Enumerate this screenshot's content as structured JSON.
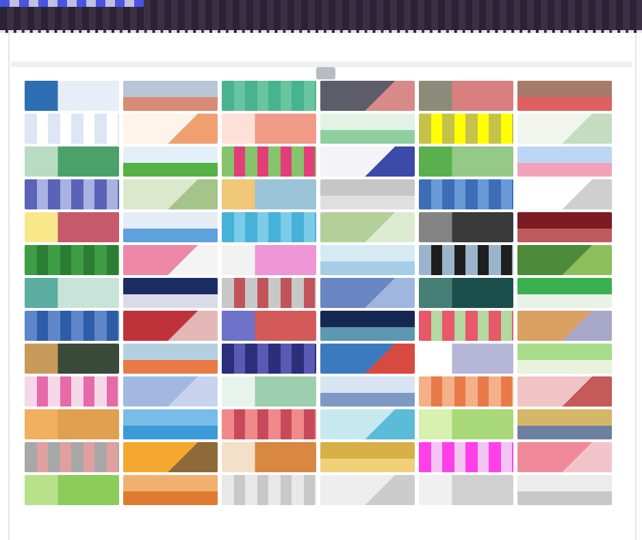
{
  "topbar": {
    "bg": "#2b2236"
  },
  "header": {
    "subtitle": ""
  },
  "thumbnails": [
    {
      "c": [
        "#2e6fb3",
        "#e8eef7"
      ]
    },
    {
      "c": [
        "#b9c6d8",
        "#d88c75"
      ]
    },
    {
      "c": [
        "#47b38f",
        "#69c4a0"
      ]
    },
    {
      "c": [
        "#5d5d6a",
        "#d88a88"
      ]
    },
    {
      "c": [
        "#8b8b7a",
        "#d87f7f"
      ]
    },
    {
      "c": [
        "#a87a6a",
        "#e06060"
      ]
    },
    {
      "c": [
        "#dde6f5",
        "#ffffff"
      ]
    },
    {
      "c": [
        "#fff4ea",
        "#f0a070"
      ]
    },
    {
      "c": [
        "#fde0d8",
        "#f29a88"
      ]
    },
    {
      "c": [
        "#e2f2e6",
        "#8fcf9f"
      ]
    },
    {
      "c": [
        "#c5c24a",
        "#ffff00"
      ]
    },
    {
      "c": [
        "#f0f5ee",
        "#c4dcc0"
      ]
    },
    {
      "c": [
        "#b8dcc2",
        "#4aa26a"
      ]
    },
    {
      "c": [
        "#e5effa",
        "#53b241"
      ]
    },
    {
      "c": [
        "#85c46a",
        "#e23e78"
      ]
    },
    {
      "c": [
        "#f4f4f8",
        "#3c4aa8"
      ]
    },
    {
      "c": [
        "#5ab04c",
        "#96c887"
      ]
    },
    {
      "c": [
        "#bcd7f4",
        "#f0a3b8"
      ]
    },
    {
      "c": [
        "#5a63b8",
        "#a9b2e0"
      ]
    },
    {
      "c": [
        "#dce8cc",
        "#a4c489"
      ]
    },
    {
      "c": [
        "#f0c878",
        "#9ac5d8"
      ]
    },
    {
      "c": [
        "#c6c6c6",
        "#e0e0e0"
      ]
    },
    {
      "c": [
        "#3c6eb8",
        "#6a9ad6"
      ]
    },
    {
      "c": [
        "#ffffff",
        "#cfcfcf"
      ]
    },
    {
      "c": [
        "#f9e88a",
        "#c65a6a"
      ]
    },
    {
      "c": [
        "#e4ecf6",
        "#5ea2de"
      ]
    },
    {
      "c": [
        "#47b2d8",
        "#7ccbe8"
      ]
    },
    {
      "c": [
        "#b4cf9a",
        "#dcebd0"
      ]
    },
    {
      "c": [
        "#848484",
        "#3a3a3a"
      ]
    },
    {
      "c": [
        "#7b1b24",
        "#bf5a5f"
      ]
    },
    {
      "c": [
        "#3d9c44",
        "#2a7d32"
      ]
    },
    {
      "c": [
        "#ee88a8",
        "#f4f4f4"
      ]
    },
    {
      "c": [
        "#f2f2f2",
        "#ee96d6"
      ]
    },
    {
      "c": [
        "#d6eaf4",
        "#a7cde6"
      ]
    },
    {
      "c": [
        "#9ab4cc",
        "#1e1e1e"
      ]
    },
    {
      "c": [
        "#4d8a3a",
        "#8cbe5a"
      ]
    },
    {
      "c": [
        "#5caea0",
        "#c8e4d8"
      ]
    },
    {
      "c": [
        "#1c2d64",
        "#d9dce6"
      ]
    },
    {
      "c": [
        "#c8c8c8",
        "#c0545a"
      ]
    },
    {
      "c": [
        "#6a86c2",
        "#9fb6de"
      ]
    },
    {
      "c": [
        "#457f76",
        "#1b4f4b"
      ]
    },
    {
      "c": [
        "#39b04f",
        "#e8f2e6"
      ]
    },
    {
      "c": [
        "#5f86c8",
        "#2d5ca8"
      ]
    },
    {
      "c": [
        "#c0323a",
        "#e5b8b8"
      ]
    },
    {
      "c": [
        "#6e72c8",
        "#d45a5a"
      ]
    },
    {
      "c": [
        "#162852",
        "#5c98b0"
      ]
    },
    {
      "c": [
        "#e85868",
        "#b3d8a0"
      ]
    },
    {
      "c": [
        "#d9a060",
        "#a8a8c8"
      ]
    },
    {
      "c": [
        "#c89a5a",
        "#3a4a3a"
      ]
    },
    {
      "c": [
        "#b4d0e0",
        "#e87a45"
      ]
    },
    {
      "c": [
        "#2a2f7a",
        "#5a5ab4"
      ]
    },
    {
      "c": [
        "#3c7ac0",
        "#d84a40"
      ]
    },
    {
      "c": [
        "#ffffff",
        "#b6b6d6"
      ]
    },
    {
      "c": [
        "#a8dc8a",
        "#e8f2dc"
      ]
    },
    {
      "c": [
        "#f4d8e8",
        "#e66aa8"
      ]
    },
    {
      "c": [
        "#a2b8e0",
        "#c8d4ee"
      ]
    },
    {
      "c": [
        "#e9f3ee",
        "#9ccfae"
      ]
    },
    {
      "c": [
        "#d8e4f2",
        "#7c9ac4"
      ]
    },
    {
      "c": [
        "#f4b088",
        "#e87a4a"
      ]
    },
    {
      "c": [
        "#f0c4c4",
        "#c45a5a"
      ]
    },
    {
      "c": [
        "#f0b060",
        "#e0a050"
      ]
    },
    {
      "c": [
        "#78bde8",
        "#3c9ad6"
      ]
    },
    {
      "c": [
        "#f08a8a",
        "#c84a5a"
      ]
    },
    {
      "c": [
        "#c8e8f0",
        "#5abcd6"
      ]
    },
    {
      "c": [
        "#d8f0b0",
        "#a8d878"
      ]
    },
    {
      "c": [
        "#d4b868",
        "#6e80a0"
      ]
    },
    {
      "c": [
        "#a8a8a8",
        "#e0a0a0"
      ]
    },
    {
      "c": [
        "#f4a830",
        "#8e6a38"
      ]
    },
    {
      "c": [
        "#f4e0c8",
        "#d88840"
      ]
    },
    {
      "c": [
        "#d8b048",
        "#f0d078"
      ]
    },
    {
      "c": [
        "#ff40e8",
        "#f4c4f4"
      ]
    },
    {
      "c": [
        "#f08a9a",
        "#f4c4cc"
      ]
    },
    {
      "c": [
        "#b8e28a",
        "#8ccc5a"
      ]
    },
    {
      "c": [
        "#f0b070",
        "#e07a30"
      ]
    },
    {
      "c": [
        "#e8e8e8",
        "#c8c8c8"
      ]
    },
    {
      "c": [
        "#eeeeee",
        "#cccccc"
      ]
    },
    {
      "c": [
        "#f0f0f0",
        "#d0d0d0"
      ]
    },
    {
      "c": [
        "#ececec",
        "#c8c8c8"
      ]
    }
  ]
}
